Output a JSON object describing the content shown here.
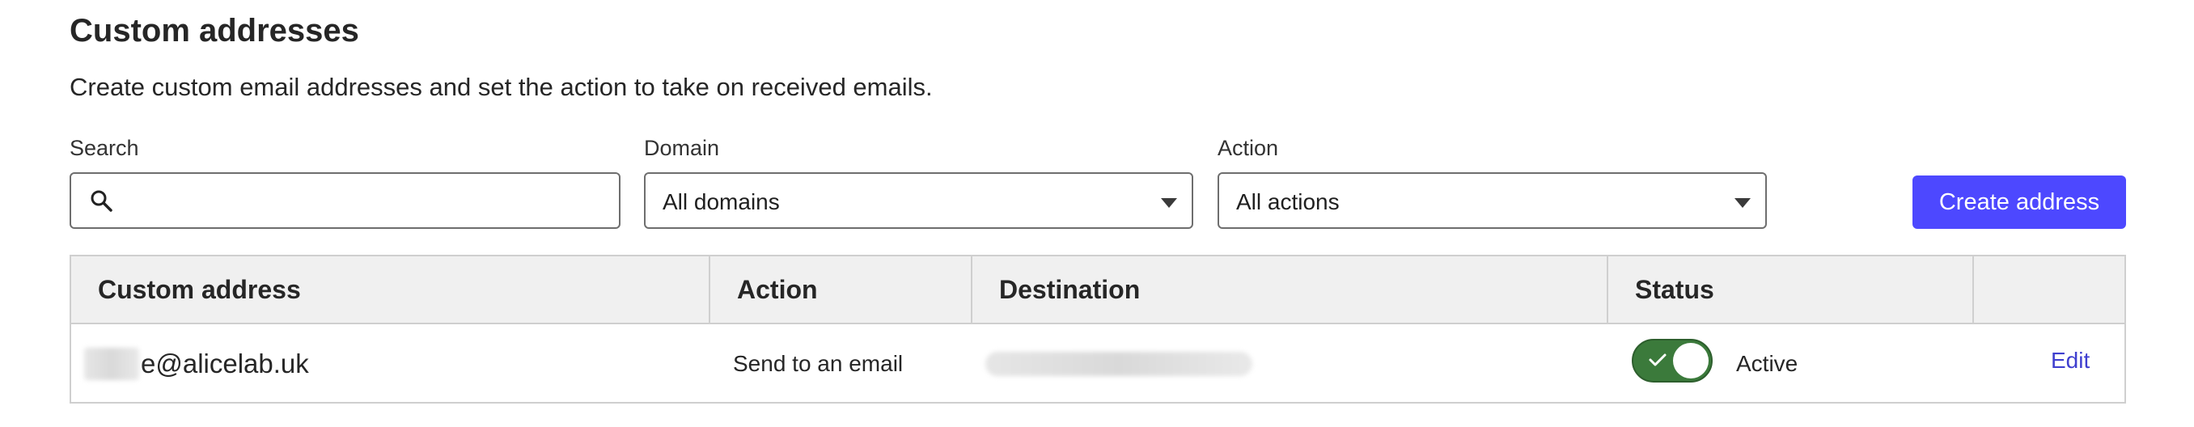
{
  "header": {
    "title": "Custom addresses",
    "subtitle": "Create custom email addresses and set the action to take on received emails."
  },
  "filters": {
    "search": {
      "label": "Search",
      "value": "",
      "icon": "search-icon"
    },
    "domain": {
      "label": "Domain",
      "selected": "All domains"
    },
    "action": {
      "label": "Action",
      "selected": "All actions"
    }
  },
  "toolbar": {
    "create_label": "Create address",
    "accent_color": "#4d48ff"
  },
  "table": {
    "columns": [
      "Custom address",
      "Action",
      "Destination",
      "Status",
      ""
    ],
    "rows": [
      {
        "address_visible": "e@alicelab.uk",
        "action": "Send to an email",
        "destination": "",
        "status_enabled": true,
        "status_label": "Active",
        "edit_label": "Edit"
      }
    ]
  },
  "colors": {
    "toggle_on": "#3b7a3b",
    "link": "#3f3fcf"
  }
}
